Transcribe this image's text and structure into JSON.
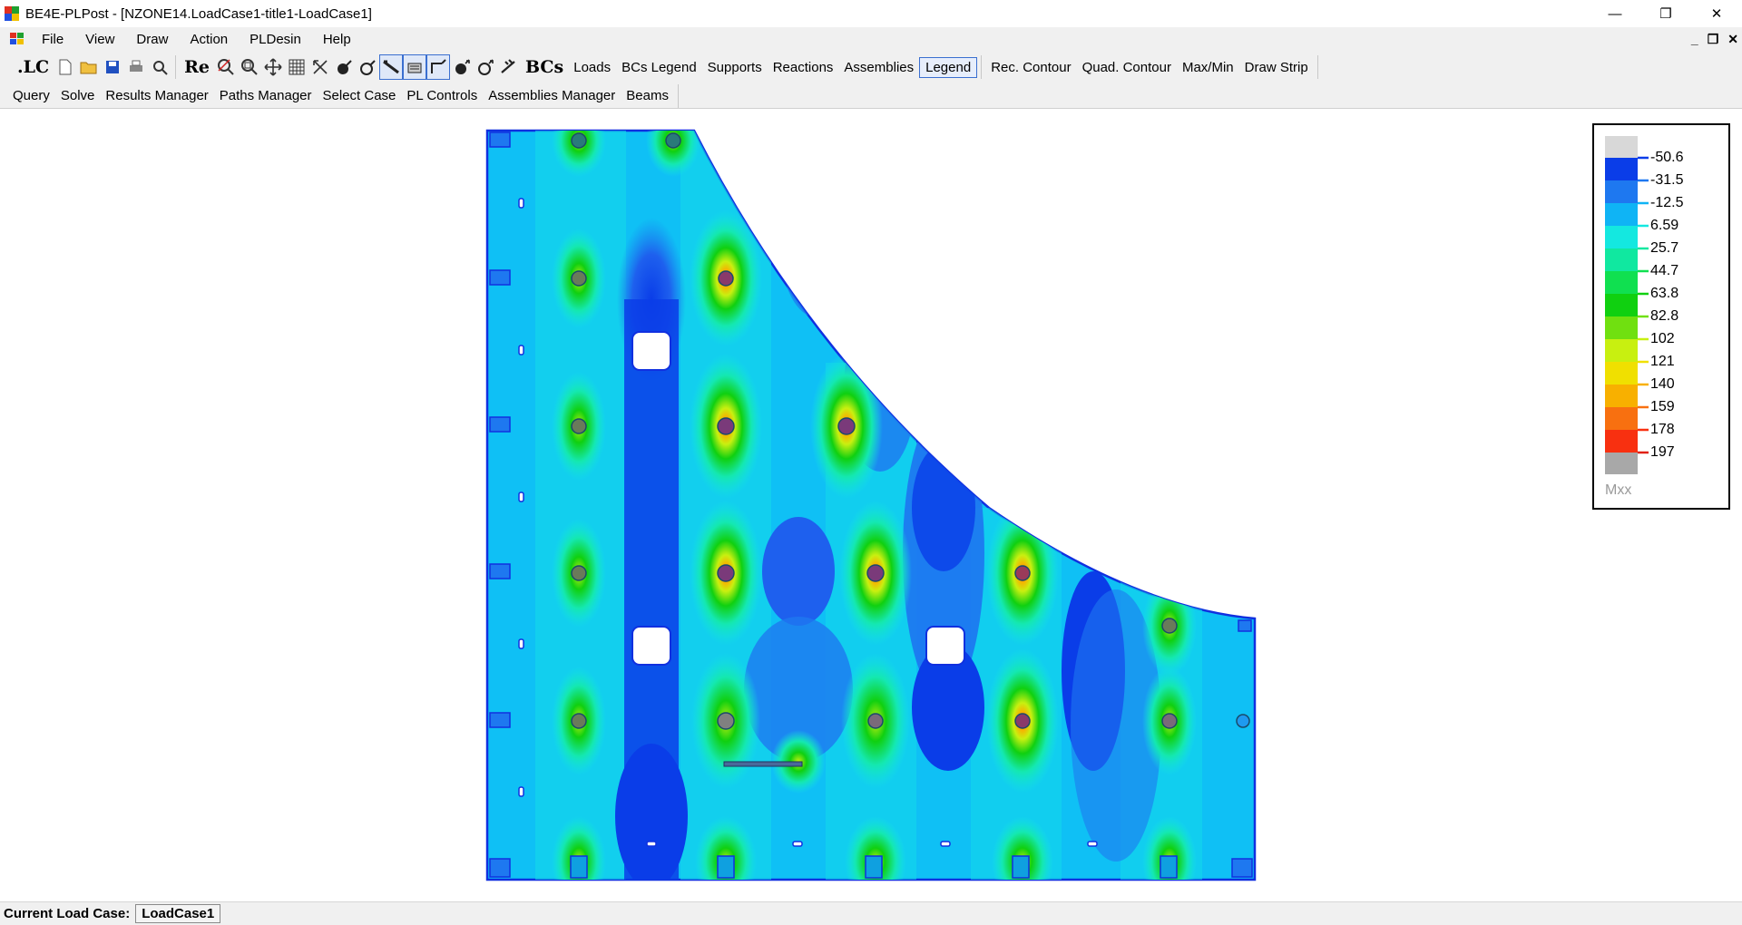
{
  "window": {
    "title": "BE4E-PLPost - [NZONE14.LoadCase1-title1-LoadCase1]",
    "minimize": "—",
    "restore": "❐",
    "close": "✕"
  },
  "menu": {
    "items": [
      "File",
      "View",
      "Draw",
      "Action",
      "PLDesin",
      "Help"
    ],
    "mdi": [
      "_",
      "❐",
      "✕"
    ]
  },
  "toolbar1": {
    "lc_label": ".LC",
    "re_label": "Re",
    "bcs_label": "BCs",
    "buttons": [
      "Loads",
      "BCs Legend",
      "Supports",
      "Reactions",
      "Assemblies",
      "Legend"
    ],
    "buttons2": [
      "Rec. Contour",
      "Quad. Contour",
      "Max/Min",
      "Draw Strip"
    ],
    "active_button": "Legend"
  },
  "toolbar2": {
    "buttons": [
      "Query",
      "Solve",
      "Results Manager",
      "Paths Manager",
      "Select Case",
      "PL Controls",
      "Assemblies Manager",
      "Beams"
    ]
  },
  "legend": {
    "title": "Mxx",
    "levels": [
      "-50.6",
      "-31.5",
      "-12.5",
      "6.59",
      "25.7",
      "44.7",
      "63.8",
      "82.8",
      "102",
      "121",
      "140",
      "159",
      "178",
      "197"
    ],
    "colors": [
      "#d8d8d8",
      "#0a3de8",
      "#1e78f0",
      "#0fb4f5",
      "#14e8e0",
      "#10e8a0",
      "#10e050",
      "#10d010",
      "#70e010",
      "#c8f010",
      "#f0e000",
      "#f8b000",
      "#f87010",
      "#f83010",
      "#a8a8a8"
    ]
  },
  "status": {
    "label": "Current Load Case:",
    "value": "LoadCase1"
  }
}
